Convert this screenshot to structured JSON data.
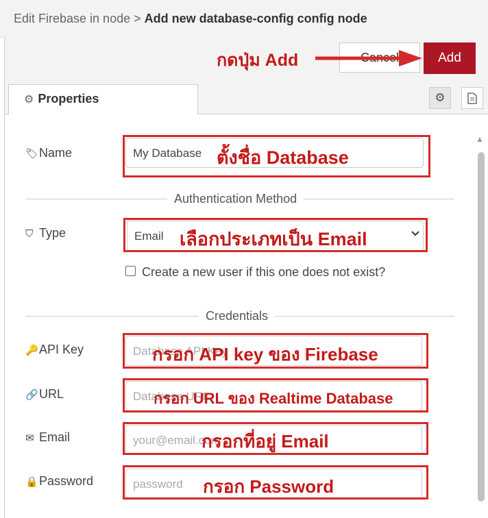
{
  "header": {
    "breadcrumb_parent": "Edit Firebase in node >",
    "breadcrumb_current": "Add new database-config config node"
  },
  "toolbar": {
    "cancel_label": "Cancel",
    "add_label": "Add",
    "annotation": "กดปุ่ม Add"
  },
  "tabs": {
    "properties_label": "Properties"
  },
  "form": {
    "name": {
      "label": "Name",
      "value": "My Database",
      "annotation": "ตั้งชื่อ Database"
    },
    "auth_section": "Authentication Method",
    "type": {
      "label": "Type",
      "value": "Email",
      "annotation": "เลือกประเภทเป็น Email"
    },
    "create_user_label": "Create a new user if this one does not exist?",
    "credentials_section": "Credentials",
    "api_key": {
      "label": "API Key",
      "placeholder": "Database API Key",
      "annotation": "กรอก API key ของ Firebase"
    },
    "url": {
      "label": "URL",
      "placeholder": "Database URL",
      "annotation": "กรอก URL ของ Realtime Database"
    },
    "email": {
      "label": "Email",
      "placeholder": "your@email.com",
      "annotation": "กรอกที่อยู่ Email"
    },
    "password": {
      "label": "Password",
      "placeholder": "password",
      "annotation": "กรอก Password"
    }
  },
  "colors": {
    "accent": "#ad1625",
    "annotation": "#c41a1a"
  },
  "icons": [
    "gear-icon",
    "tag-icon",
    "shield-icon",
    "key-icon",
    "link-icon",
    "envelope-icon",
    "lock-icon",
    "document-icon",
    "chevron-down-icon",
    "arrow-right-icon"
  ]
}
